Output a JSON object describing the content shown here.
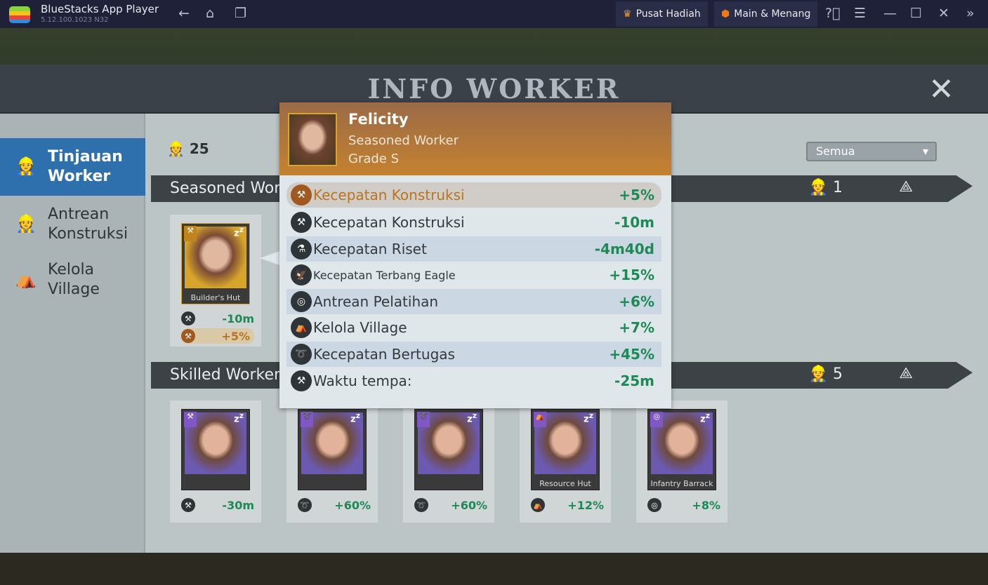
{
  "titlebar": {
    "app_name": "BlueStacks App Player",
    "version": "5.12.100.1023  N32",
    "rewards": "Pusat Hadiah",
    "play_win": "Main & Menang"
  },
  "panel": {
    "title": "INFO WORKER",
    "filter": "Semua",
    "total_count": "25"
  },
  "sidebar": [
    {
      "label": "Tinjauan Worker",
      "active": true
    },
    {
      "label": "Antrean Konstruksi"
    },
    {
      "label": "Kelola Village"
    }
  ],
  "sections": [
    {
      "title": "Seasoned Worker",
      "count": "1",
      "cards": [
        {
          "label": "Builder's Hut",
          "stats": [
            {
              "icon": "hammer-icon",
              "value": "-10m"
            },
            {
              "icon": "hammer-icon",
              "value": "+5%",
              "highlight": true
            }
          ]
        }
      ]
    },
    {
      "title": "Skilled Worker",
      "count": "5",
      "cards": [
        {
          "label": "",
          "icon": "anvil-icon",
          "value": "-30m"
        },
        {
          "label": "",
          "icon": "horn-icon",
          "value": "+60%"
        },
        {
          "label": "",
          "icon": "horn-icon",
          "value": "+60%"
        },
        {
          "label": "Resource Hut",
          "icon": "tent-icon",
          "value": "+12%"
        },
        {
          "label": "Infantry Barrack",
          "icon": "target-swords-icon",
          "value": "+8%"
        }
      ]
    }
  ],
  "popup": {
    "name": "Felicity",
    "type": "Seasoned Worker",
    "grade": "Grade S",
    "stats": [
      {
        "icon": "hammer-icon",
        "label": "Kecepatan Konstruksi",
        "value": "+5%",
        "highlight": true
      },
      {
        "icon": "hammer-icon",
        "label": "Kecepatan Konstruksi",
        "value": "-10m"
      },
      {
        "icon": "flask-icon",
        "label": "Kecepatan Riset",
        "value": "-4m40d"
      },
      {
        "icon": "eagle-icon",
        "label": "Kecepatan Terbang Eagle",
        "value": "+15%"
      },
      {
        "icon": "target-swords-icon",
        "label": "Antrean Pelatihan",
        "value": "+6%"
      },
      {
        "icon": "tent-icon",
        "label": "Kelola Village",
        "value": "+7%"
      },
      {
        "icon": "horn-icon",
        "label": "Kecepatan Bertugas",
        "value": "+45%"
      },
      {
        "icon": "anvil-icon",
        "label": "Waktu tempa:",
        "value": "-25m"
      }
    ]
  },
  "colors": {
    "accent": "#2e70ad",
    "positive": "#1d8a55",
    "highlight": "#b9741f",
    "popup_header": "#c4822f",
    "skilled_badge": "#8157c6"
  }
}
